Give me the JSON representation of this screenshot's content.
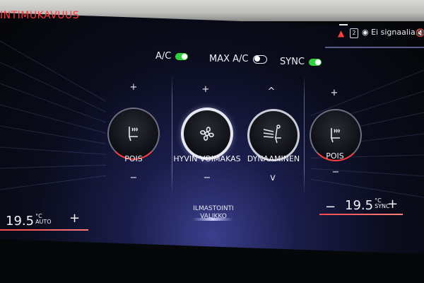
{
  "screen": {
    "title": "INTIMUKAVUUS"
  },
  "status": {
    "signal_text": "Ei signaalia.",
    "badge": "2"
  },
  "toggles": [
    {
      "label": "A/C",
      "state": "on"
    },
    {
      "label": "MAX A/C",
      "state": "off"
    },
    {
      "label": "SYNC",
      "state": "on"
    }
  ],
  "controls": {
    "left_seat": {
      "label": "POIS",
      "plus": "+",
      "minus": "−"
    },
    "fan": {
      "label": "HYVIN VOIMAKAS",
      "plus": "+",
      "minus": "−"
    },
    "mode": {
      "label": "DYNAAMINEN",
      "up": "^",
      "down": "v"
    },
    "right_seat": {
      "label": "POIS",
      "plus": "+",
      "minus": "−"
    }
  },
  "climate": {
    "left_temp": "19.5",
    "left_unit": "°C",
    "left_mode": "AUTO",
    "right_temp": "19.5",
    "right_unit": "°C",
    "right_mode": "SYNC",
    "plus": "+",
    "minus": "−"
  },
  "vent": {
    "line1": "ILMASTOINTI",
    "line2": "VALIKKO"
  },
  "colors": {
    "accent_red": "#ff3b3b",
    "toggle_on": "#2fd13a",
    "heat": "#ff7a2a"
  }
}
